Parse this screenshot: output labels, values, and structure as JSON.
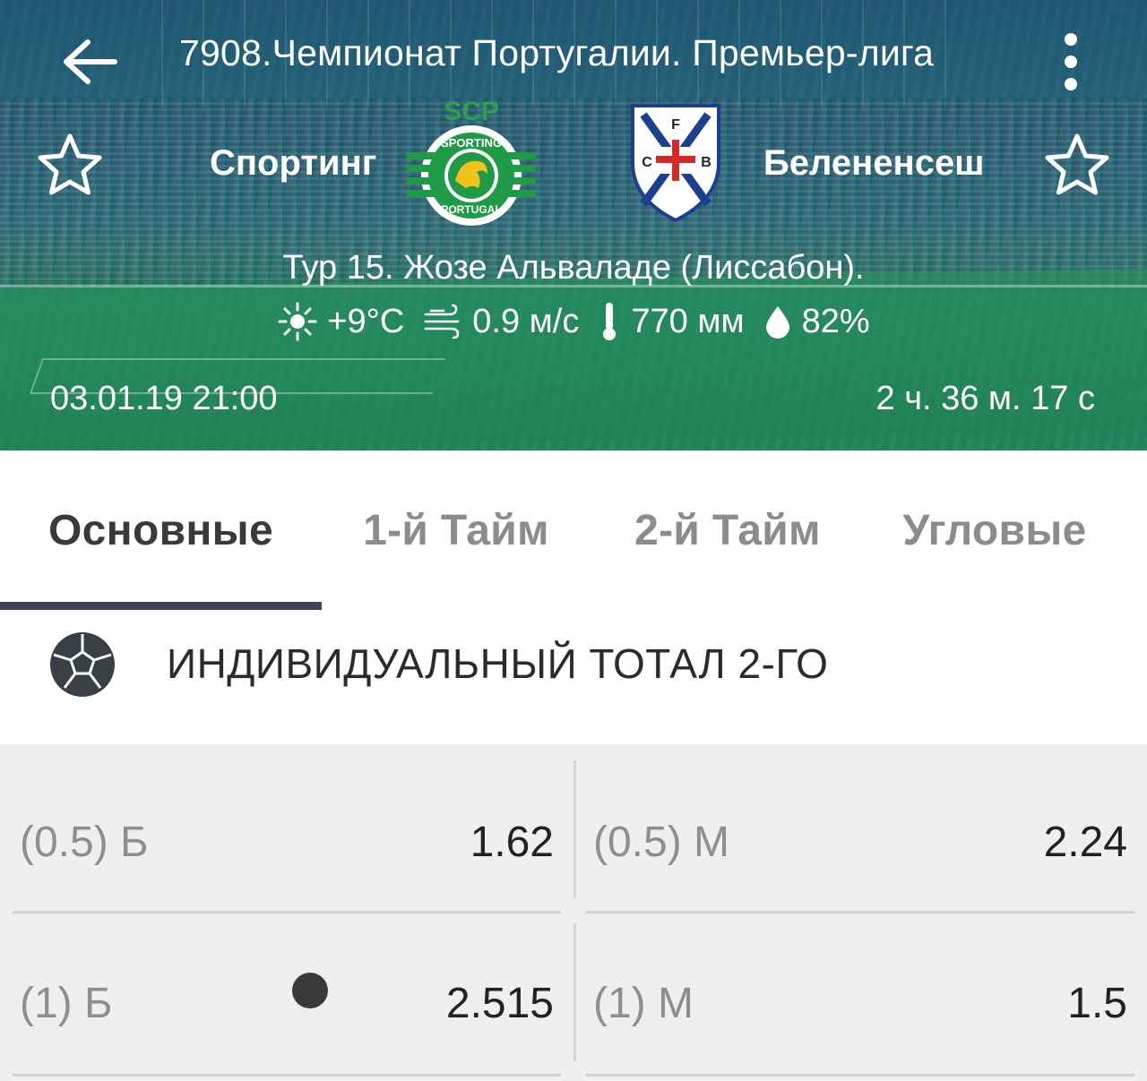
{
  "header": {
    "league_title": "7908.Чемпионат Португалии. Премьер-лига",
    "back_icon": "arrow-left-icon",
    "more_icon": "more-vertical-icon",
    "home_team": {
      "name": "Спортинг",
      "logo": "sporting-cp-logo",
      "logo_text_top": "SCP",
      "logo_text_ring_top": "SPORTING",
      "logo_text_ring_bottom": "PORTUGAL"
    },
    "away_team": {
      "name": "Белененсеш",
      "logo": "belenenses-logo",
      "logo_letters": [
        "C",
        "F",
        "B"
      ]
    },
    "venue": "Тур 15. Жозе Альваладе (Лиссабон).",
    "weather": {
      "temperature": "+9°C",
      "wind": "0.9 м/с",
      "pressure": "770 мм",
      "humidity": "82%"
    },
    "datetime": "03.01.19 21:00",
    "countdown": "2 ч. 36 м. 17 с"
  },
  "tabs": [
    {
      "label": "Основные",
      "active": true
    },
    {
      "label": "1-й  Тайм",
      "active": false
    },
    {
      "label": "2-й  Тайм",
      "active": false
    },
    {
      "label": "Угловые",
      "active": false
    }
  ],
  "market": {
    "icon": "soccer-ball-icon",
    "title": "ИНДИВИДУАЛЬНЫЙ ТОТАЛ 2-ГО",
    "rows": [
      {
        "left": {
          "label": "(0.5) Б",
          "value": "1.62"
        },
        "right": {
          "label": "(0.5) М",
          "value": "2.24"
        }
      },
      {
        "left": {
          "label": "(1) Б",
          "value": "2.515"
        },
        "right": {
          "label": "(1) М",
          "value": "1.5"
        }
      }
    ]
  },
  "colors": {
    "header_overlay": "#14506e",
    "tab_indicator": "#3e4652",
    "odds_background": "#efefef"
  }
}
